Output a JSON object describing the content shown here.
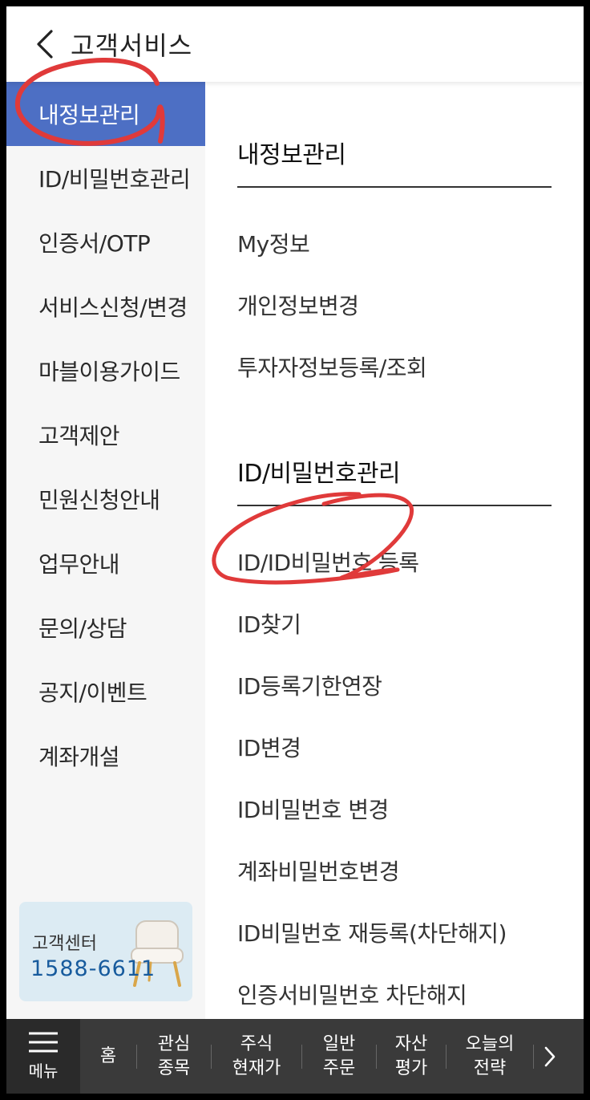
{
  "header": {
    "title": "고객서비스"
  },
  "sidebar": {
    "items": [
      {
        "label": "내정보관리",
        "active": true
      },
      {
        "label": "ID/비밀번호관리"
      },
      {
        "label": "인증서/OTP"
      },
      {
        "label": "서비스신청/변경"
      },
      {
        "label": "마블이용가이드"
      },
      {
        "label": "고객제안"
      },
      {
        "label": "민원신청안내"
      },
      {
        "label": "업무안내"
      },
      {
        "label": "문의/상담"
      },
      {
        "label": "공지/이벤트"
      },
      {
        "label": "계좌개설"
      }
    ],
    "customer_center": {
      "label": "고객센터",
      "phone": "1588-6611"
    }
  },
  "content": {
    "sections": [
      {
        "title": "내정보관리",
        "items": [
          "My정보",
          "개인정보변경",
          "투자자정보등록/조회"
        ]
      },
      {
        "title": "ID/비밀번호관리",
        "items": [
          "ID/ID비밀번호 등록",
          "ID찾기",
          "ID등록기한연장",
          "ID변경",
          "ID비밀번호 변경",
          "계좌비밀번호변경",
          "ID비밀번호 재등록(차단해지)",
          "인증서비밀번호 차단해지"
        ]
      }
    ]
  },
  "bottom_nav": {
    "menu_label": "메뉴",
    "items": [
      "홈",
      "관심\n종목",
      "주식\n현재가",
      "일반\n주문",
      "자산\n평가",
      "오늘의\n전략"
    ]
  },
  "colors": {
    "accent": "#4d6fc4",
    "annotation": "#e03a3a",
    "nav_bg": "#3a3a3a"
  }
}
